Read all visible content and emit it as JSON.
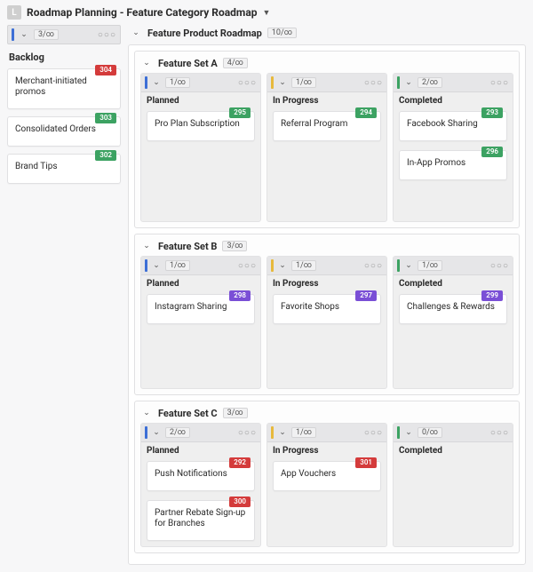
{
  "app": {
    "badge": "L",
    "title": "Roadmap Planning - Feature Category Roadmap"
  },
  "backlog": {
    "count": "3/∞",
    "title": "Backlog",
    "items": [
      {
        "label": "Merchant-initiated promos",
        "badge": "304",
        "color": "b-red"
      },
      {
        "label": "Consolidated Orders",
        "badge": "303",
        "color": "b-green"
      },
      {
        "label": "Brand Tips",
        "badge": "302",
        "color": "b-green"
      }
    ]
  },
  "roadmap": {
    "title": "Feature Product Roadmap",
    "count": "10/∞",
    "sets": [
      {
        "title": "Feature Set A",
        "count": "4/∞",
        "planned": {
          "count": "1/∞",
          "title": "Planned",
          "cards": [
            {
              "label": "Pro Plan Subscription",
              "badge": "295",
              "color": "b-green"
            }
          ]
        },
        "inprogress": {
          "count": "1/∞",
          "title": "In Progress",
          "cards": [
            {
              "label": "Referral Program",
              "badge": "294",
              "color": "b-green"
            }
          ]
        },
        "completed": {
          "count": "2/∞",
          "title": "Completed",
          "cards": [
            {
              "label": "Facebook Sharing",
              "badge": "293",
              "color": "b-green"
            },
            {
              "label": "In-App Promos",
              "badge": "296",
              "color": "b-green"
            }
          ]
        }
      },
      {
        "title": "Feature Set B",
        "count": "3/∞",
        "planned": {
          "count": "1/∞",
          "title": "Planned",
          "cards": [
            {
              "label": "Instagram Sharing",
              "badge": "298",
              "color": "b-purple"
            }
          ]
        },
        "inprogress": {
          "count": "1/∞",
          "title": "In Progress",
          "cards": [
            {
              "label": "Favorite Shops",
              "badge": "297",
              "color": "b-purple"
            }
          ]
        },
        "completed": {
          "count": "1/∞",
          "title": "Completed",
          "cards": [
            {
              "label": "Challenges & Rewards",
              "badge": "299",
              "color": "b-purple"
            }
          ]
        }
      },
      {
        "title": "Feature Set C",
        "count": "3/∞",
        "planned": {
          "count": "2/∞",
          "title": "Planned",
          "cards": [
            {
              "label": "Push Notifications",
              "badge": "292",
              "color": "b-red"
            },
            {
              "label": "Partner Rebate Sign-up for Branches",
              "badge": "300",
              "color": "b-red"
            }
          ]
        },
        "inprogress": {
          "count": "1/∞",
          "title": "In Progress",
          "cards": [
            {
              "label": "App Vouchers",
              "badge": "301",
              "color": "b-red"
            }
          ]
        },
        "completed": {
          "count": "0/∞",
          "title": "Completed",
          "cards": []
        }
      }
    ]
  }
}
